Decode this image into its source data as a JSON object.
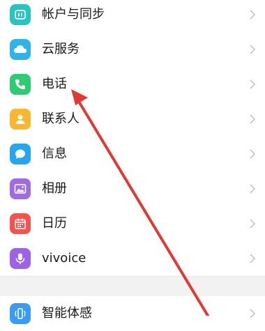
{
  "settings": {
    "items": [
      {
        "label": "帐户与同步",
        "icon": "account-sync-icon",
        "color": "#27c4c2"
      },
      {
        "label": "云服务",
        "icon": "cloud-icon",
        "color": "#2fb3e8"
      },
      {
        "label": "电话",
        "icon": "phone-icon",
        "color": "#2ecb73"
      },
      {
        "label": "联系人",
        "icon": "contact-icon",
        "color": "#f7b731"
      },
      {
        "label": "信息",
        "icon": "message-icon",
        "color": "#27a6ee"
      },
      {
        "label": "相册",
        "icon": "gallery-icon",
        "color": "#a06ce0"
      },
      {
        "label": "日历",
        "icon": "calendar-icon",
        "color": "#f5534f"
      },
      {
        "label": "vivoice",
        "icon": "microphone-icon",
        "color": "#9c63e6"
      },
      {
        "label": "智能体感",
        "icon": "smart-motion-icon",
        "color": "#3a9bf0"
      }
    ]
  },
  "annotation": {
    "color": "#e03a34",
    "icon": "red-arrow-annotation"
  }
}
